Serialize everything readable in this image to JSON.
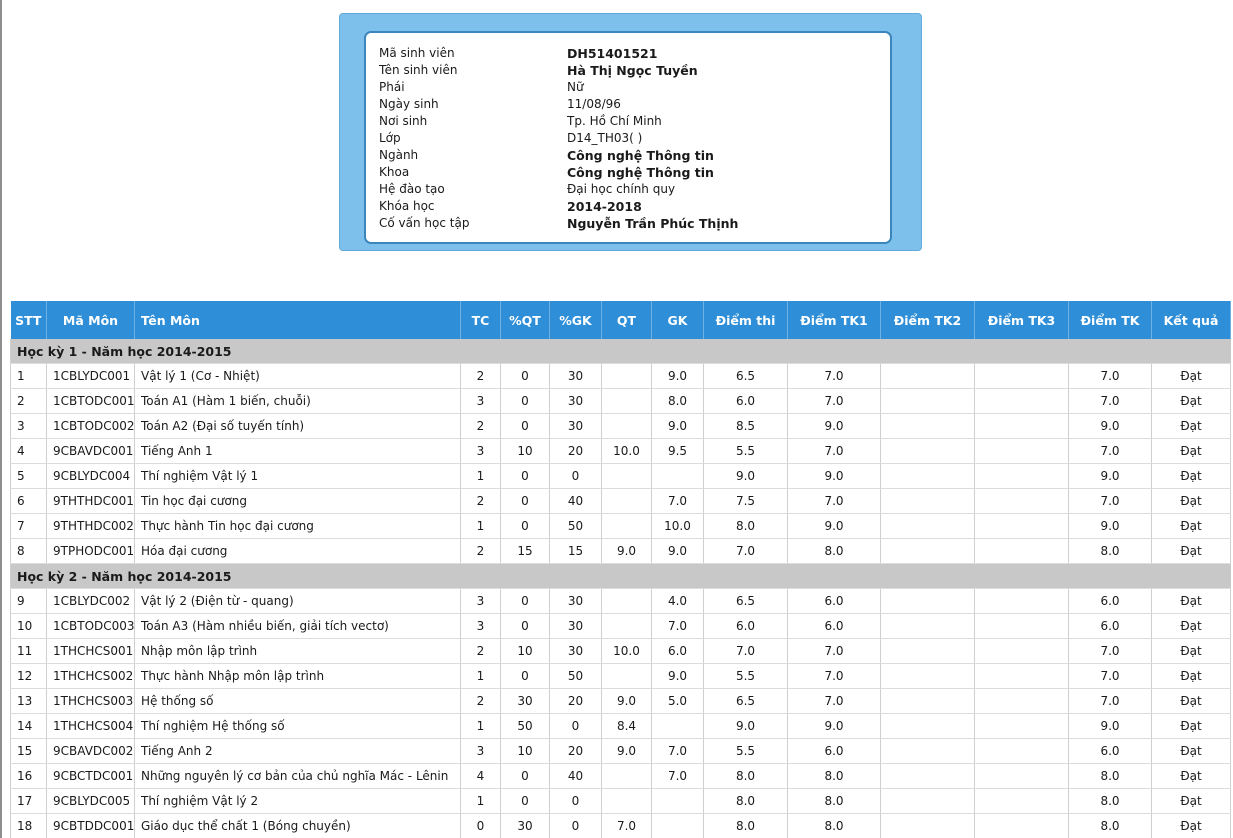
{
  "student": {
    "fields": [
      {
        "label": "Mã sinh viên",
        "value": "DH51401521",
        "bold": true
      },
      {
        "label": "Tên sinh viên",
        "value": "Hà Thị Ngọc Tuyền",
        "bold": true
      },
      {
        "label": "Phái",
        "value": "Nữ",
        "bold": false
      },
      {
        "label": "Ngày sinh",
        "value": "11/08/96",
        "bold": false
      },
      {
        "label": "Nơi sinh",
        "value": "Tp. Hồ Chí Minh",
        "bold": false
      },
      {
        "label": "Lớp",
        "value": "D14_TH03( )",
        "bold": false
      },
      {
        "label": "Ngành",
        "value": "Công nghệ Thông tin",
        "bold": true
      },
      {
        "label": "Khoa",
        "value": "Công nghệ Thông tin",
        "bold": true
      },
      {
        "label": "Hệ đào tạo",
        "value": "Đại học chính quy",
        "bold": false
      },
      {
        "label": "Khóa học",
        "value": "2014-2018",
        "bold": true
      },
      {
        "label": "Cố vấn học tập",
        "value": "Nguyễn Trần Phúc Thịnh",
        "bold": true
      }
    ]
  },
  "table": {
    "headers": [
      "STT",
      "Mã Môn",
      "Tên Môn",
      "TC",
      "%QT",
      "%GK",
      "QT",
      "GK",
      "Điểm thi",
      "Điểm TK1",
      "Điểm TK2",
      "Điểm TK3",
      "Điểm TK",
      "Kết quả"
    ],
    "semesters": [
      {
        "title": "Học kỳ 1 - Năm học 2014-2015",
        "rows": [
          [
            "1",
            "1CBLYDC001",
            "Vật lý 1 (Cơ - Nhiệt)",
            "2",
            "0",
            "30",
            "",
            "9.0",
            "6.5",
            "7.0",
            "",
            "",
            "7.0",
            "Đạt"
          ],
          [
            "2",
            "1CBTODC001",
            "Toán A1 (Hàm 1 biến, chuỗi)",
            "3",
            "0",
            "30",
            "",
            "8.0",
            "6.0",
            "7.0",
            "",
            "",
            "7.0",
            "Đạt"
          ],
          [
            "3",
            "1CBTODC002",
            "Toán A2 (Đại số tuyến tính)",
            "2",
            "0",
            "30",
            "",
            "9.0",
            "8.5",
            "9.0",
            "",
            "",
            "9.0",
            "Đạt"
          ],
          [
            "4",
            "9CBAVDC001",
            "Tiếng Anh 1",
            "3",
            "10",
            "20",
            "10.0",
            "9.5",
            "5.5",
            "7.0",
            "",
            "",
            "7.0",
            "Đạt"
          ],
          [
            "5",
            "9CBLYDC004",
            "Thí nghiệm Vật lý 1",
            "1",
            "0",
            "0",
            "",
            "",
            "9.0",
            "9.0",
            "",
            "",
            "9.0",
            "Đạt"
          ],
          [
            "6",
            "9THTHDC001",
            "Tin học đại cương",
            "2",
            "0",
            "40",
            "",
            "7.0",
            "7.5",
            "7.0",
            "",
            "",
            "7.0",
            "Đạt"
          ],
          [
            "7",
            "9THTHDC002",
            "Thực hành Tin học đại cương",
            "1",
            "0",
            "50",
            "",
            "10.0",
            "8.0",
            "9.0",
            "",
            "",
            "9.0",
            "Đạt"
          ],
          [
            "8",
            "9TPHODC001",
            "Hóa đại cương",
            "2",
            "15",
            "15",
            "9.0",
            "9.0",
            "7.0",
            "8.0",
            "",
            "",
            "8.0",
            "Đạt"
          ]
        ]
      },
      {
        "title": "Học kỳ 2 - Năm học 2014-2015",
        "rows": [
          [
            "9",
            "1CBLYDC002",
            "Vật lý 2 (Điện từ - quang)",
            "3",
            "0",
            "30",
            "",
            "4.0",
            "6.5",
            "6.0",
            "",
            "",
            "6.0",
            "Đạt"
          ],
          [
            "10",
            "1CBTODC003",
            "Toán A3 (Hàm nhiều biến, giải tích vectơ)",
            "3",
            "0",
            "30",
            "",
            "7.0",
            "6.0",
            "6.0",
            "",
            "",
            "6.0",
            "Đạt"
          ],
          [
            "11",
            "1THCHCS001",
            "Nhập môn lập trình",
            "2",
            "10",
            "30",
            "10.0",
            "6.0",
            "7.0",
            "7.0",
            "",
            "",
            "7.0",
            "Đạt"
          ],
          [
            "12",
            "1THCHCS002",
            "Thực hành Nhập môn lập trình",
            "1",
            "0",
            "50",
            "",
            "9.0",
            "5.5",
            "7.0",
            "",
            "",
            "7.0",
            "Đạt"
          ],
          [
            "13",
            "1THCHCS003",
            "Hệ thống số",
            "2",
            "30",
            "20",
            "9.0",
            "5.0",
            "6.5",
            "7.0",
            "",
            "",
            "7.0",
            "Đạt"
          ],
          [
            "14",
            "1THCHCS004",
            "Thí nghiệm Hệ thống số",
            "1",
            "50",
            "0",
            "8.4",
            "",
            "9.0",
            "9.0",
            "",
            "",
            "9.0",
            "Đạt"
          ],
          [
            "15",
            "9CBAVDC002",
            "Tiếng Anh 2",
            "3",
            "10",
            "20",
            "9.0",
            "7.0",
            "5.5",
            "6.0",
            "",
            "",
            "6.0",
            "Đạt"
          ],
          [
            "16",
            "9CBCTDC001",
            "Những nguyên lý cơ bản của chủ nghĩa Mác - Lênin",
            "4",
            "0",
            "40",
            "",
            "7.0",
            "8.0",
            "8.0",
            "",
            "",
            "8.0",
            "Đạt"
          ],
          [
            "17",
            "9CBLYDC005",
            "Thí nghiệm Vật lý 2",
            "1",
            "0",
            "0",
            "",
            "",
            "8.0",
            "8.0",
            "",
            "",
            "8.0",
            "Đạt"
          ],
          [
            "18",
            "9CBTDDC001",
            "Giáo dục thể chất 1 (Bóng chuyền)",
            "0",
            "30",
            "0",
            "7.0",
            "",
            "8.0",
            "8.0",
            "",
            "",
            "8.0",
            "Đạt"
          ]
        ]
      }
    ]
  }
}
